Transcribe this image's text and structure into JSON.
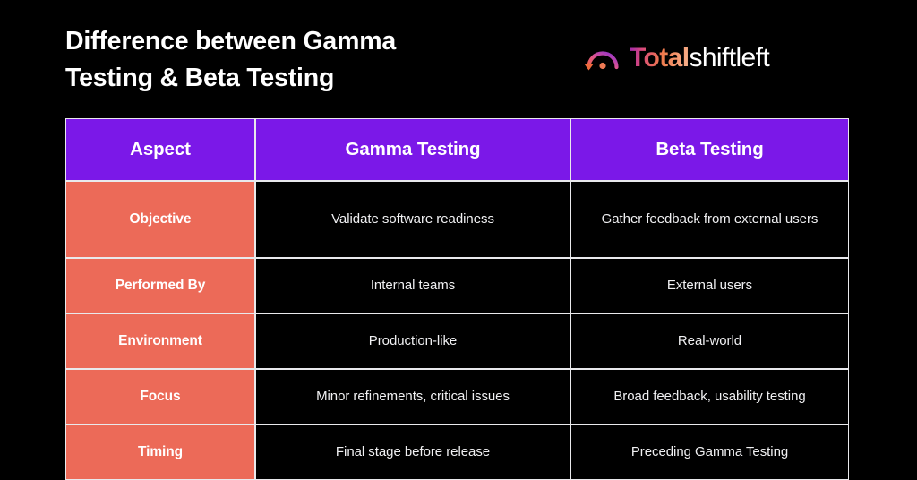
{
  "background_color": "#000000",
  "title": {
    "line1": "Difference between Gamma",
    "line2": "Testing & Beta Testing"
  },
  "logo": {
    "icon_name": "shift-left-arc-arrow-icon",
    "text_primary": "Total",
    "text_secondary": "shiftleft",
    "gradient_start": "#9c27b0",
    "gradient_mid": "#ef7b4c",
    "gradient_end": "#f7b48e",
    "secondary_color": "#ffffff"
  },
  "table": {
    "header_bg": "#7b18e8",
    "aspect_bg": "#ec6a58",
    "border_color": "#e9e9ec",
    "headers": [
      "Aspect",
      "Gamma Testing",
      "Beta Testing"
    ],
    "rows": [
      {
        "aspect": "Objective",
        "gamma": "Validate software readiness",
        "beta": "Gather feedback from external users"
      },
      {
        "aspect": "Performed By",
        "gamma": "Internal teams",
        "beta": "External users"
      },
      {
        "aspect": "Environment",
        "gamma": "Production-like",
        "beta": "Real-world"
      },
      {
        "aspect": "Focus",
        "gamma": "Minor refinements, critical issues",
        "beta": "Broad feedback, usability testing"
      },
      {
        "aspect": "Timing",
        "gamma": "Final stage before release",
        "beta": "Preceding Gamma Testing"
      }
    ]
  }
}
